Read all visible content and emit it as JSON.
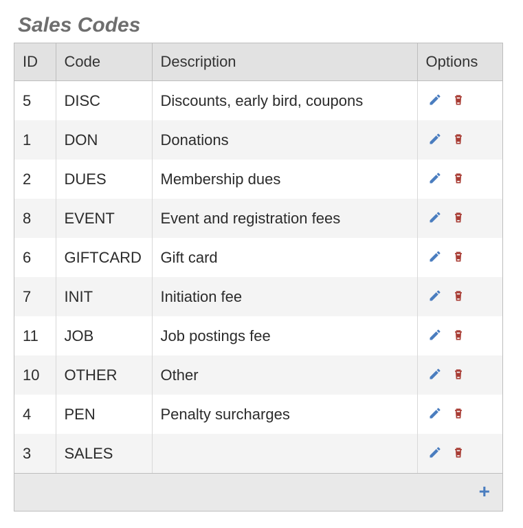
{
  "title": "Sales Codes",
  "columns": {
    "id": "ID",
    "code": "Code",
    "description": "Description",
    "options": "Options"
  },
  "rows": [
    {
      "id": "5",
      "code": "DISC",
      "description": "Discounts, early bird, coupons"
    },
    {
      "id": "1",
      "code": "DON",
      "description": "Donations"
    },
    {
      "id": "2",
      "code": "DUES",
      "description": "Membership dues"
    },
    {
      "id": "8",
      "code": "EVENT",
      "description": "Event and registration fees"
    },
    {
      "id": "6",
      "code": "GIFTCARD",
      "description": "Gift card"
    },
    {
      "id": "7",
      "code": "INIT",
      "description": "Initiation fee"
    },
    {
      "id": "11",
      "code": "JOB",
      "description": "Job postings fee"
    },
    {
      "id": "10",
      "code": "OTHER",
      "description": "Other"
    },
    {
      "id": "4",
      "code": "PEN",
      "description": "Penalty surcharges"
    },
    {
      "id": "3",
      "code": "SALES",
      "description": ""
    }
  ],
  "icons": {
    "edit_color": "#4a7dbf",
    "delete_color": "#a83c34",
    "add_color": "#4a7dbf"
  },
  "add_label": "+"
}
